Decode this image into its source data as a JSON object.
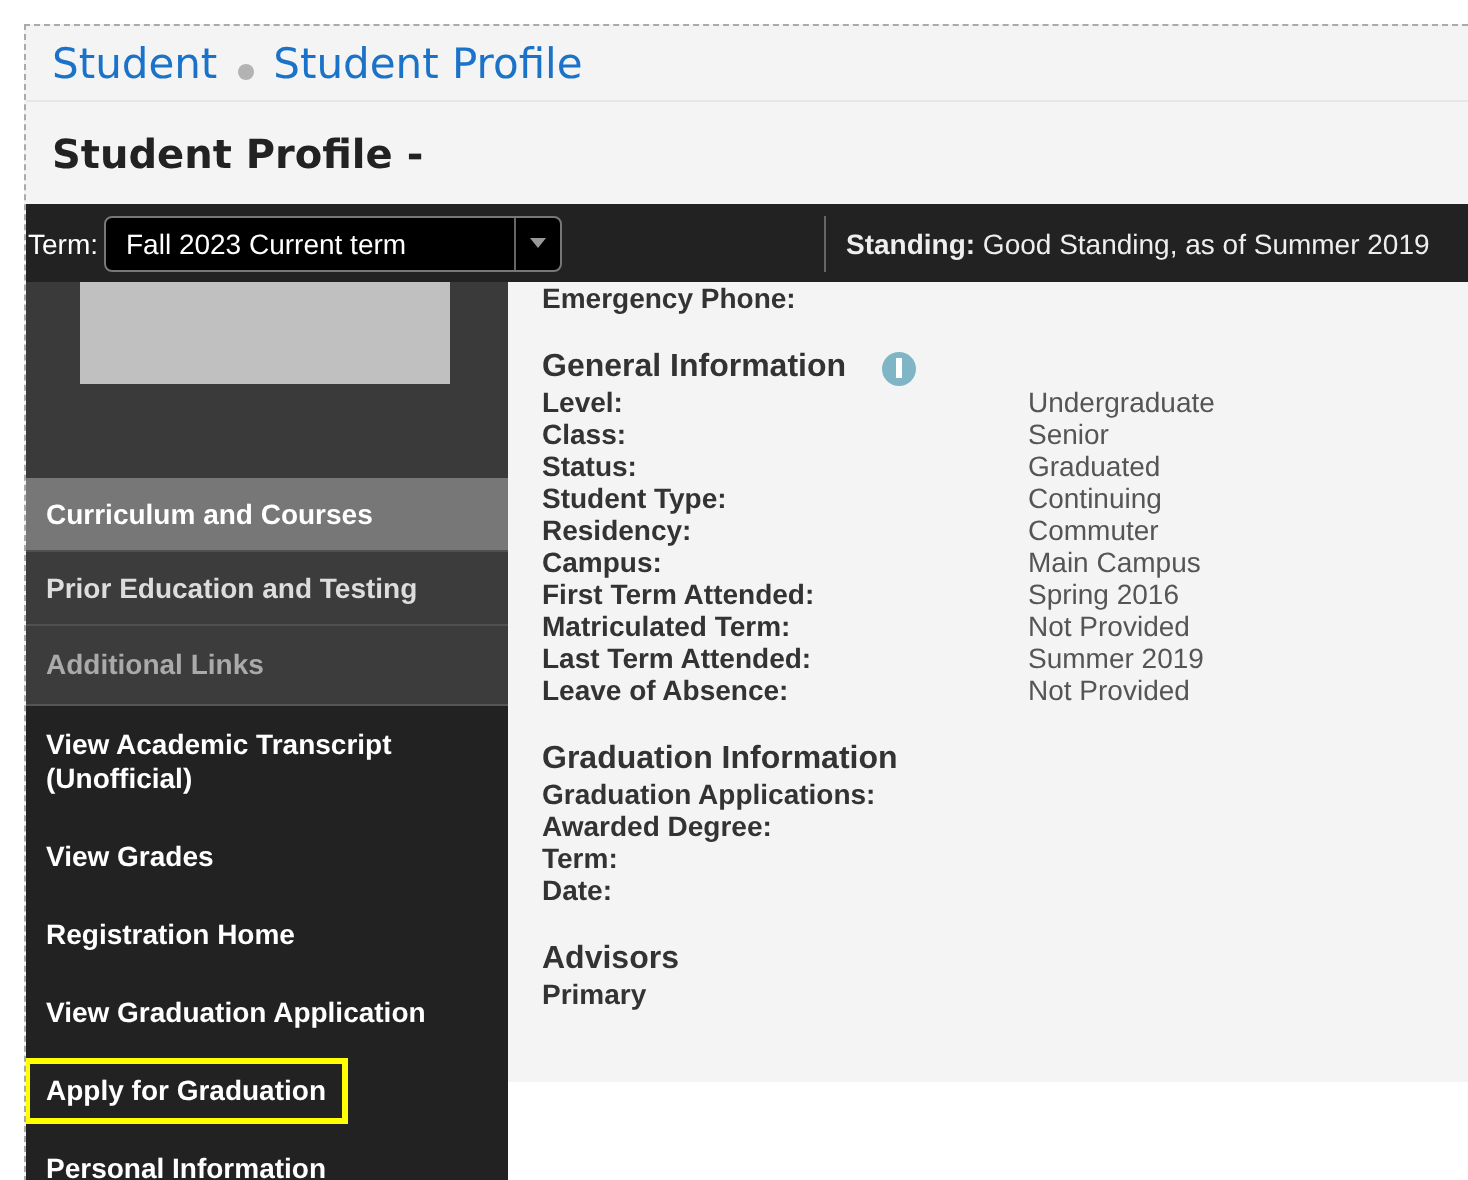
{
  "breadcrumbs": [
    {
      "label": "Student"
    },
    {
      "label": "Student Profile"
    }
  ],
  "page_title": "Student Profile -",
  "term_bar": {
    "label": "Term:",
    "value": "Fall 2023 Current term",
    "standing_label": "Standing:",
    "standing_value": "Good Standing, as of Summer 2019"
  },
  "sidebar": {
    "items": [
      {
        "kind": "section",
        "label": "Curriculum and Courses",
        "selected": true
      },
      {
        "kind": "section",
        "label": "Prior Education and Testing",
        "selected": false
      },
      {
        "kind": "header",
        "label": "Additional Links"
      },
      {
        "kind": "link",
        "label": "View Academic Transcript (Unofficial)",
        "highlighted": false
      },
      {
        "kind": "link",
        "label": "View Grades",
        "highlighted": false
      },
      {
        "kind": "link",
        "label": "Registration Home",
        "highlighted": false
      },
      {
        "kind": "link",
        "label": "View Graduation Application",
        "highlighted": false
      },
      {
        "kind": "link",
        "label": "Apply for Graduation",
        "highlighted": true
      },
      {
        "kind": "link",
        "label": "Personal Information",
        "highlighted": false
      }
    ]
  },
  "sections": [
    {
      "fields": [
        {
          "label": "Emergency Phone:"
        }
      ]
    },
    {
      "title": "General Information",
      "info": true,
      "fields": [
        {
          "label": "Level:",
          "value": "Undergraduate"
        },
        {
          "label": "Class:",
          "value": "Senior"
        },
        {
          "label": "Status:",
          "value": "Graduated"
        },
        {
          "label": "Student Type:",
          "value": "Continuing"
        },
        {
          "label": "Residency:",
          "value": "Commuter"
        },
        {
          "label": "Campus:",
          "value": "Main Campus"
        },
        {
          "label": "First Term Attended:",
          "value": "Spring 2016"
        },
        {
          "label": "Matriculated Term:",
          "value": "Not Provided"
        },
        {
          "label": "Last Term Attended:",
          "value": "Summer 2019"
        },
        {
          "label": "Leave of Absence:",
          "value": "Not Provided"
        }
      ]
    },
    {
      "title": "Graduation Information",
      "info": false,
      "fields": [
        {
          "label": "Graduation Applications:"
        },
        {
          "label": "Awarded Degree:"
        },
        {
          "label": "Term:"
        },
        {
          "label": "Date:"
        }
      ]
    },
    {
      "title": "Advisors",
      "info": false,
      "fields": [
        {
          "label": "Primary"
        }
      ]
    }
  ]
}
